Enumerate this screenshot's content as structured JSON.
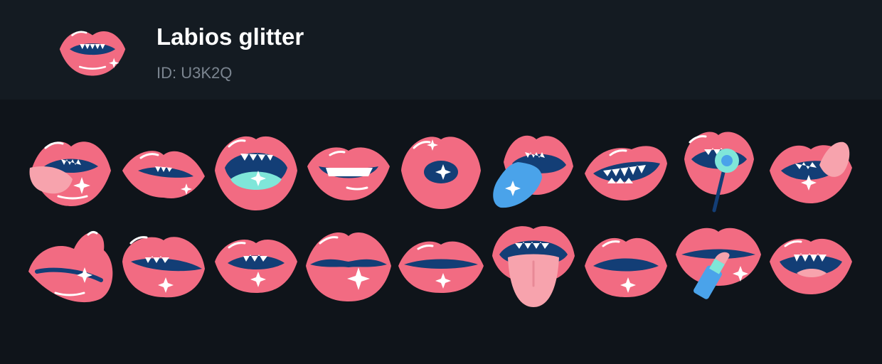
{
  "pack": {
    "title": "Labios glitter",
    "id_text": "ID: U3K2Q"
  },
  "colors": {
    "lip": "#f26b82",
    "lip_dark": "#e05a72",
    "mouth": "#133e76",
    "teeth": "#ffffff",
    "tongue": "#f7a3ad",
    "blue_tongue": "#4aa3ea",
    "mint": "#7fe6d9"
  },
  "stickers": [
    {
      "name": "sticker-tongue-out-side",
      "icon": "lips-tongue-side"
    },
    {
      "name": "sticker-biting-lip",
      "icon": "lips-biting"
    },
    {
      "name": "sticker-open-mouth-mint",
      "icon": "lips-open-mint"
    },
    {
      "name": "sticker-smile-teeth",
      "icon": "lips-smile"
    },
    {
      "name": "sticker-kiss-o",
      "icon": "lips-kiss-o"
    },
    {
      "name": "sticker-blue-tongue",
      "icon": "lips-blue-tongue"
    },
    {
      "name": "sticker-grin",
      "icon": "lips-grin"
    },
    {
      "name": "sticker-lollipop",
      "icon": "lips-lollipop"
    },
    {
      "name": "sticker-tongue-lick",
      "icon": "lips-lick"
    },
    {
      "name": "sticker-pout-side",
      "icon": "lips-pout-side"
    },
    {
      "name": "sticker-teeth-bite",
      "icon": "lips-teeth-bite"
    },
    {
      "name": "sticker-small-bite",
      "icon": "lips-small-bite"
    },
    {
      "name": "sticker-closed-wide",
      "icon": "lips-closed-wide"
    },
    {
      "name": "sticker-closed-slim",
      "icon": "lips-closed-slim"
    },
    {
      "name": "sticker-tongue-down",
      "icon": "lips-tongue-down"
    },
    {
      "name": "sticker-closed-pucker",
      "icon": "lips-pucker"
    },
    {
      "name": "sticker-lipstick",
      "icon": "lips-lipstick"
    },
    {
      "name": "sticker-smile-bottom",
      "icon": "lips-smile-bottom"
    }
  ]
}
